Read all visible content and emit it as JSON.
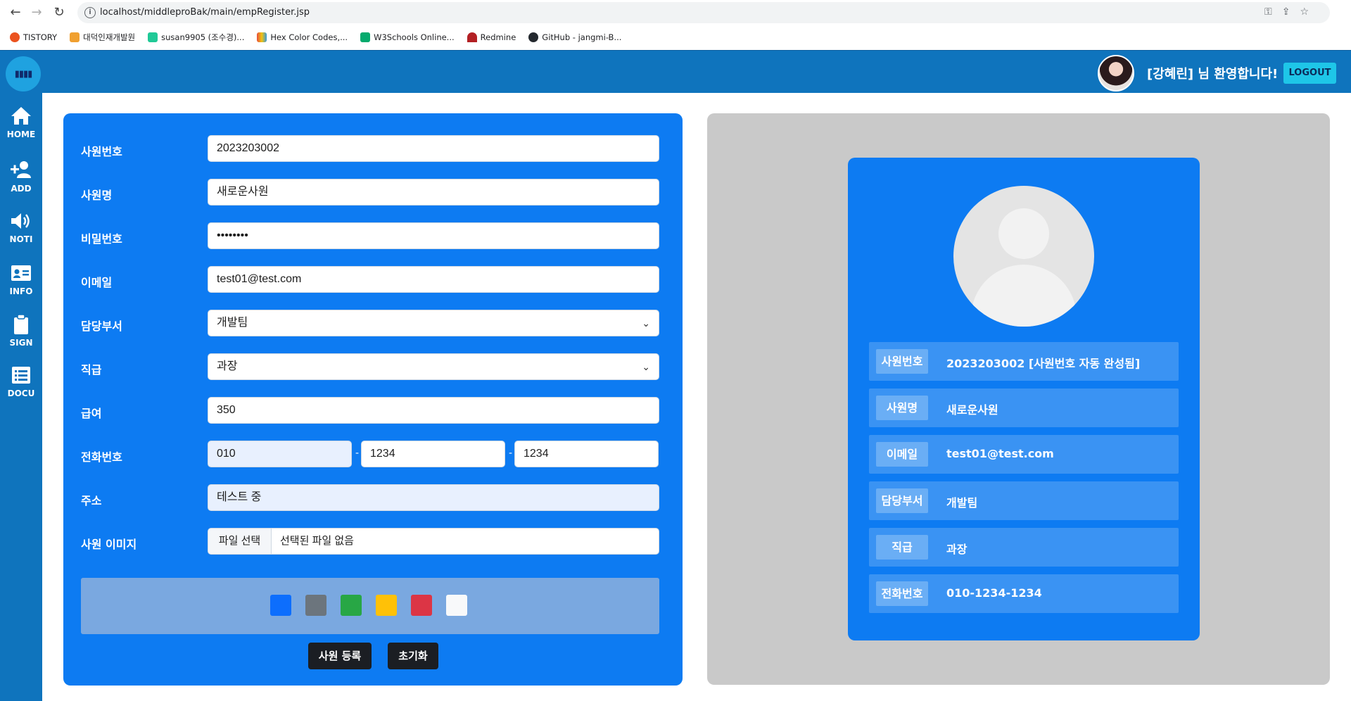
{
  "browser": {
    "url": "localhost/middleproBak/main/empRegister.jsp",
    "bookmarks": [
      {
        "label": "TISTORY",
        "color": "#eb531f"
      },
      {
        "label": "대덕인재개발원",
        "color": "#f0a030"
      },
      {
        "label": "susan9905 (조수경)...",
        "color": "#20c997"
      },
      {
        "label": "Hex Color Codes,...",
        "color": "#e84c3d"
      },
      {
        "label": "W3Schools Online...",
        "color": "#04aa6d"
      },
      {
        "label": "Redmine",
        "color": "#b32024"
      },
      {
        "label": "GitHub - jangmi-B...",
        "color": "#24292f"
      }
    ]
  },
  "header": {
    "welcome": "[강혜린] 님 환영합니다!",
    "logout": "LOGOUT"
  },
  "sidebar": {
    "items": [
      {
        "label": "HOME",
        "icon": "home-icon"
      },
      {
        "label": "ADD",
        "icon": "add-user-icon"
      },
      {
        "label": "NOTI",
        "icon": "speaker-icon"
      },
      {
        "label": "INFO",
        "icon": "id-card-icon"
      },
      {
        "label": "SIGN",
        "icon": "clipboard-icon"
      },
      {
        "label": "DOCU",
        "icon": "list-icon"
      }
    ]
  },
  "form": {
    "emp_no": {
      "label": "사원번호",
      "value": "2023203002"
    },
    "emp_name": {
      "label": "사원명",
      "value": "새로운사원"
    },
    "password": {
      "label": "비밀번호",
      "value": "••••••••"
    },
    "email": {
      "label": "이메일",
      "value": "test01@test.com"
    },
    "dept": {
      "label": "담당부서",
      "value": "개발팀"
    },
    "position": {
      "label": "직급",
      "value": "과장"
    },
    "salary": {
      "label": "급여",
      "value": "350"
    },
    "phone": {
      "label": "전화번호",
      "p1": "010",
      "p2": "1234",
      "p3": "1234",
      "sep": "-"
    },
    "address": {
      "label": "주소",
      "value": "테스트 중"
    },
    "image": {
      "label": "사원 이미지",
      "button": "파일 선택",
      "status": "선택된 파일 없음"
    },
    "swatches": [
      "#0d6efd",
      "#6c757d",
      "#28a745",
      "#ffc107",
      "#dc3545",
      "#f8f9fa"
    ],
    "submit": "사원 등록",
    "reset": "초기화"
  },
  "preview": {
    "rows": [
      {
        "label": "사원번호",
        "value": "2023203002 [사원번호 자동 완성됨]"
      },
      {
        "label": "사원명",
        "value": "새로운사원"
      },
      {
        "label": "이메일",
        "value": "test01@test.com"
      },
      {
        "label": "담당부서",
        "value": "개발팀"
      },
      {
        "label": "직급",
        "value": "과장"
      },
      {
        "label": "전화번호",
        "value": "010-1234-1234"
      }
    ]
  }
}
